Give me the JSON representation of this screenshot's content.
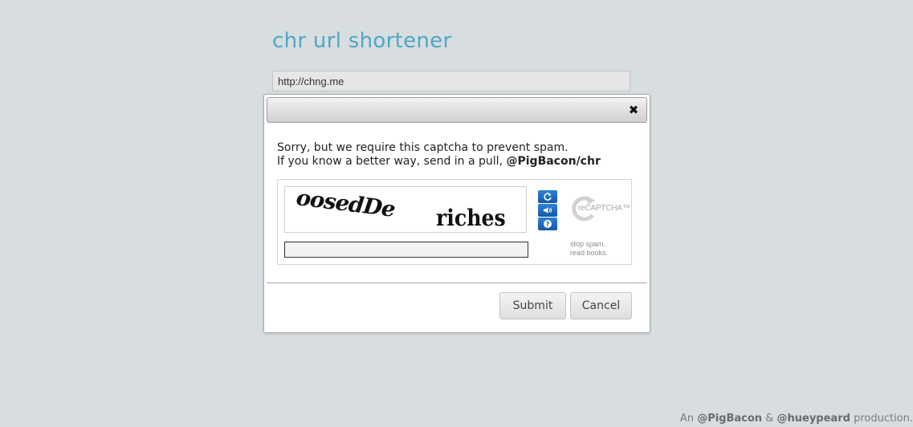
{
  "app": {
    "title": "chr url shortener"
  },
  "url_input": {
    "value": "http://chng.me"
  },
  "modal": {
    "message": {
      "line1": "Sorry, but we require this captcha to prevent spam.",
      "line2_prefix": "If you know a better way, send in a pull,",
      "handle": "@PigBacon/chr"
    },
    "recaptcha": {
      "challenge_word_1": "oosedDe",
      "challenge_word_2": "riches",
      "response_value": "",
      "logo_text": "reCAPTCHA™",
      "tagline_line1": "stop spam.",
      "tagline_line2": "read books.",
      "icons": [
        "refresh-icon",
        "audio-icon",
        "help-icon",
        "recaptcha-logo-icon"
      ]
    },
    "buttons": {
      "submit": "Submit",
      "cancel": "Cancel"
    }
  },
  "footer": {
    "prefix": "An",
    "handle1": "@PigBacon",
    "ampersand": "&",
    "handle2": "@hueypeard",
    "suffix": "production."
  },
  "colors": {
    "background": "#d8dde0",
    "title": "#4fa7c4",
    "recaptcha_button": "#1f6fc2"
  }
}
